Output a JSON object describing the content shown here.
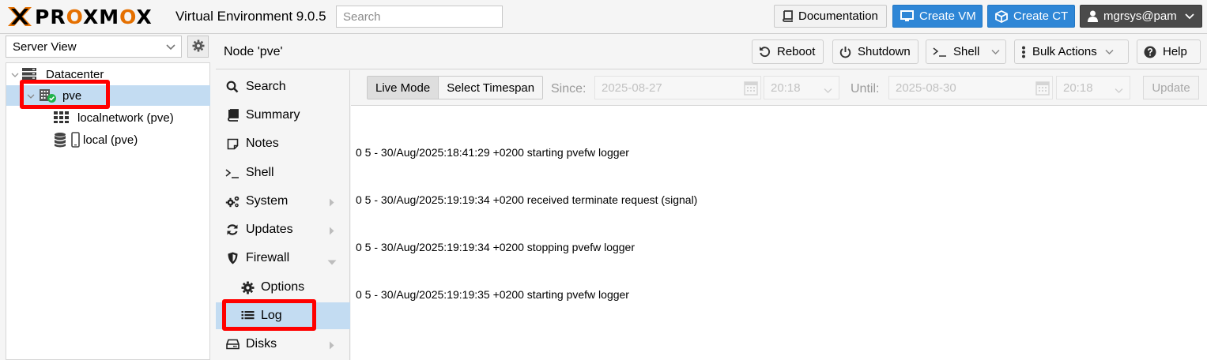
{
  "app": {
    "logo_text_1": "PR",
    "logo_text_o": "O",
    "logo_text_2": "XM",
    "logo_text_o2": "O",
    "logo_text_3": "X",
    "title": "Virtual Environment 9.0.5"
  },
  "search": {
    "placeholder": "Search",
    "value": ""
  },
  "topbar": {
    "documentation": "Documentation",
    "create_vm": "Create VM",
    "create_ct": "Create CT",
    "user": "mgrsys@pam"
  },
  "left": {
    "view": "Server View",
    "tree": [
      {
        "label": "Datacenter",
        "icon": "server-stack-icon"
      },
      {
        "label": "pve",
        "icon": "node-online-icon"
      },
      {
        "label": "localnetwork (pve)",
        "icon": "grid-icon"
      },
      {
        "label": "local (pve)",
        "icon": "storage-icon"
      }
    ]
  },
  "header": {
    "title": "Node 'pve'",
    "reboot": "Reboot",
    "shutdown": "Shutdown",
    "shell": "Shell",
    "bulk_actions": "Bulk Actions",
    "help": "Help"
  },
  "nav": [
    {
      "label": "Search",
      "icon": "search-icon"
    },
    {
      "label": "Summary",
      "icon": "book-icon"
    },
    {
      "label": "Notes",
      "icon": "note-icon"
    },
    {
      "label": "Shell",
      "icon": "terminal-icon"
    },
    {
      "label": "System",
      "icon": "cogs-icon"
    },
    {
      "label": "Updates",
      "icon": "refresh-icon"
    },
    {
      "label": "Firewall",
      "icon": "shield-icon"
    },
    {
      "label": "Options",
      "icon": "gear-icon"
    },
    {
      "label": "Log",
      "icon": "list-icon"
    },
    {
      "label": "Disks",
      "icon": "hdd-icon"
    }
  ],
  "log_toolbar": {
    "live_mode": "Live Mode",
    "select_timespan": "Select Timespan",
    "since_label": "Since:",
    "since_date": "2025-08-27",
    "since_time": "20:18",
    "until_label": "Until:",
    "until_date": "2025-08-30",
    "until_time": "20:18",
    "update": "Update"
  },
  "log_lines": [
    "0 5 - 30/Aug/2025:18:41:29 +0200 starting pvefw logger",
    "0 5 - 30/Aug/2025:19:19:34 +0200 received terminate request (signal)",
    "0 5 - 30/Aug/2025:19:19:34 +0200 stopping pvefw logger",
    "0 5 - 30/Aug/2025:19:19:35 +0200 starting pvefw logger"
  ],
  "colors": {
    "accent_orange": "#e57000",
    "button_blue": "#2e86d6",
    "selection": "#c3dcf2",
    "highlight_red": "#ff0000",
    "online_green": "#21b24b"
  }
}
